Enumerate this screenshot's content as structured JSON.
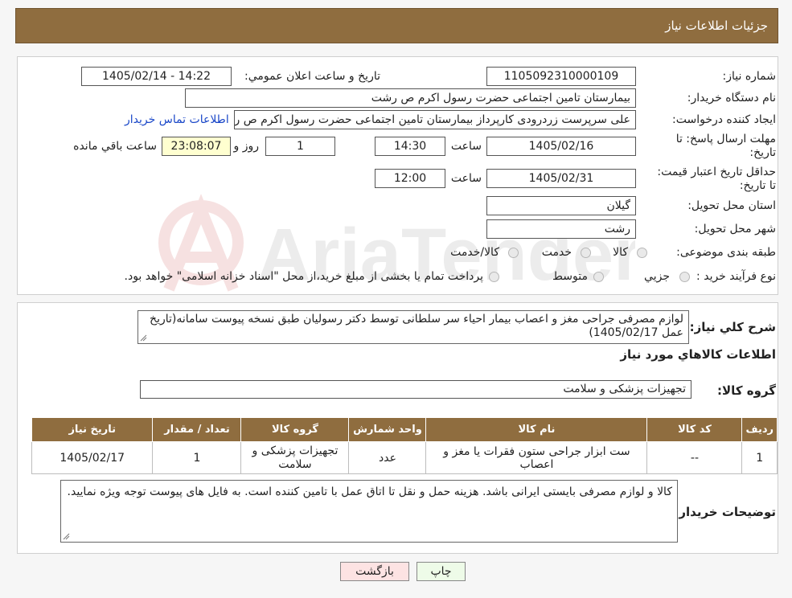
{
  "header": {
    "title": "جزئیات اطلاعات نیاز"
  },
  "labels": {
    "need_number": "شماره نیاز:",
    "announce_datetime": "تاریخ و ساعت اعلان عمومي:",
    "buyer_org": "نام دستگاه خریدار:",
    "requester": "ایجاد کننده درخواست:",
    "contact_link": "اطلاعات تماس خریدار",
    "reply_deadline": "مهلت ارسال پاسخ: تا تاریخ:",
    "time": "ساعت",
    "day_and": "روز و",
    "remaining": "ساعت باقي مانده",
    "price_validity": "حداقل تاریخ اعتبار قیمت: تا تاریخ:",
    "delivery_province": "استان محل تحویل:",
    "delivery_city": "شهر محل تحویل:",
    "subject_category": "طبقه بندی موضوعی:",
    "purchase_process": "نوع فرآیند خرید :",
    "need_description": "شرح کلي نیاز:",
    "goods_info": "اطلاعات کالاهاي مورد نیاز",
    "goods_group": "گروه کالا:",
    "buyer_notes": "توضیحات خریدار:"
  },
  "values": {
    "need_number": "1105092310000109",
    "announce_datetime": "1405/02/14 - 14:22",
    "buyer_org": "بیمارستان  تامین اجتماعی حضرت رسول اکرم ص رشت",
    "requester": "علی سرپرست زردرودی کارپرداز بیمارستان  تامین اجتماعی حضرت رسول اکرم ص رشت",
    "reply_date": "1405/02/16",
    "reply_time": "14:30",
    "reply_days": "1",
    "reply_remaining": "23:08:07",
    "validity_date": "1405/02/31",
    "validity_time": "12:00",
    "province": "گیلان",
    "city": "رشت",
    "need_description": "لوازم مصرفی جراحی مغز و اعصاب بیمار احیاء سر سلطانی توسط دکتر رسولیان طبق نسخه پیوست سامانه(تاریخ عمل 1405/02/17)",
    "goods_group": "تجهیزات پزشکی و سلامت",
    "buyer_notes": "کالا و لوازم مصرفی بایستی ایرانی باشد. هزینه حمل و نقل تا اتاق عمل با تامین کننده است. به فایل های پیوست توجه ویژه نمایید."
  },
  "category_options": [
    "کالا",
    "خدمت",
    "کالا/خدمت"
  ],
  "process_options": [
    "جزیي",
    "متوسط"
  ],
  "process_note": "پرداخت تمام یا بخشی از مبلغ خرید،از محل \"اسناد خزانه اسلامی\" خواهد بود.",
  "table": {
    "headers": [
      "ردیف",
      "کد کالا",
      "نام کالا",
      "واحد شمارش",
      "گروه کالا",
      "تعداد / مقدار",
      "تاریخ نیاز"
    ],
    "rows": [
      [
        "1",
        "--",
        "ست ابزار جراحی ستون فقرات یا مغز و اعصاب",
        "عدد",
        "تجهیزات پزشکی و سلامت",
        "1",
        "1405/02/17"
      ]
    ]
  },
  "buttons": {
    "print": "چاپ",
    "back": "بازگشت"
  },
  "colors": {
    "header_bg": "#8f6d3f",
    "link": "#1a47c8",
    "highlight": "#ffffd0",
    "back_button": "#fde3e3"
  },
  "watermark": {
    "text": "AriaTender.neT"
  }
}
